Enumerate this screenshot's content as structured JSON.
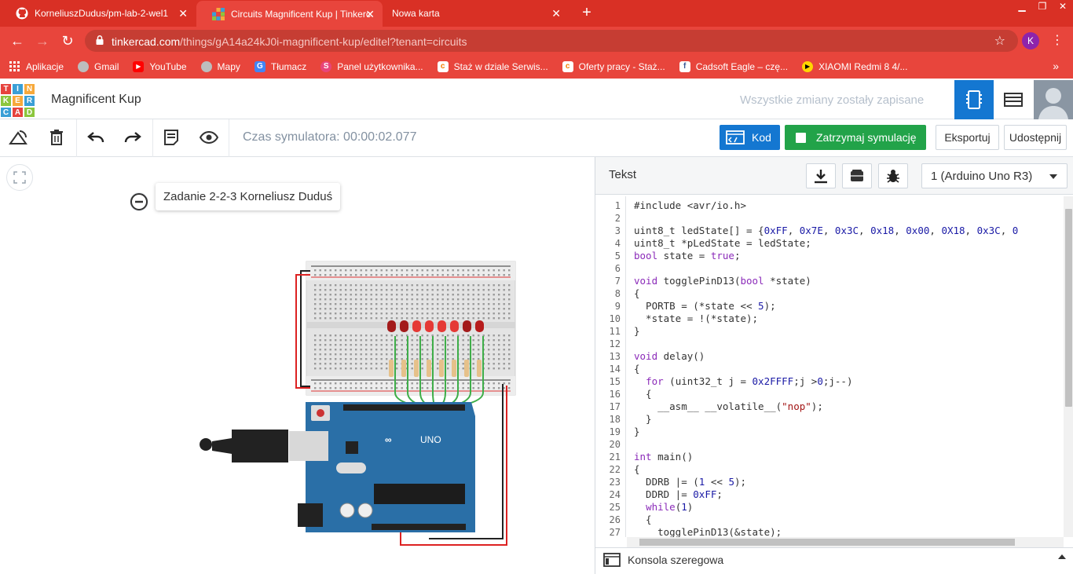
{
  "browser": {
    "tabs": [
      {
        "title": "KorneliuszDudus/pm-lab-2-wel1",
        "icon": "github-icon",
        "active": false
      },
      {
        "title": "Circuits Magnificent Kup | Tinkerc",
        "icon": "tinkercad-icon",
        "active": true
      },
      {
        "title": "Nowa karta",
        "icon": "",
        "active": false
      }
    ],
    "url_host": "tinkercad.com",
    "url_path": "/things/gA14a24kJ0i-magnificent-kup/editel?tenant=circuits",
    "profile_initial": "K",
    "bookmarks": [
      {
        "label": "Aplikacje",
        "icon": "apps-grid-icon"
      },
      {
        "label": "Gmail",
        "icon": "globe-icon"
      },
      {
        "label": "YouTube",
        "icon": "youtube-icon"
      },
      {
        "label": "Mapy",
        "icon": "globe-icon"
      },
      {
        "label": "Tłumacz",
        "icon": "translate-icon"
      },
      {
        "label": "Panel użytkownika...",
        "icon": "pink-logo-icon"
      },
      {
        "label": "Staż w dziale Serwis...",
        "icon": "orange-logo-icon"
      },
      {
        "label": "Oferty pracy - Staż...",
        "icon": "orange-logo-icon"
      },
      {
        "label": "Cadsoft Eagle – czę...",
        "icon": "facebook-icon"
      },
      {
        "label": "XIAOMI Redmi 8 4/...",
        "icon": "play-yellow-icon"
      }
    ]
  },
  "app": {
    "logo_letters": [
      "T",
      "I",
      "N",
      "K",
      "E",
      "R",
      "C",
      "A",
      "D"
    ],
    "project_title": "Magnificent Kup",
    "save_status": "Wszystkie zmiany zostały zapisane",
    "sim_time_label": "Czas symulatora: 00:00:02.077",
    "buttons": {
      "code": "Kod",
      "stop": "Zatrzymaj symulację",
      "export": "Eksportuj",
      "share": "Udostępnij"
    },
    "canvas_note": "Zadanie 2-2-3 Korneliusz Duduś"
  },
  "code_panel": {
    "title": "Tekst",
    "device": "1 (Arduino Uno R3)",
    "serial_label": "Konsola szeregowa",
    "lines": [
      "#include <avr/io.h>",
      "",
      "uint8_t ledState[] = {0xFF, 0x7E, 0x3C, 0x18, 0x00, 0X18, 0x3C, 0",
      "uint8_t *pLedState = ledState;",
      "bool state = true;",
      "",
      "void togglePinD13(bool *state)",
      "{",
      "  PORTB = (*state << 5);",
      "  *state = !(*state);",
      "}",
      "",
      "void delay()",
      "{",
      "  for (uint32_t j = 0x2FFFF;j >0;j--)",
      "  {",
      "    __asm__ __volatile__(\"nop\");",
      "  }",
      "}",
      "",
      "int main()",
      "{",
      "  DDRB |= (1 << 5);",
      "  DDRD |= 0xFF;",
      "  while(1)",
      "  {",
      "    togglePinD13(&state);",
      ""
    ]
  },
  "colors": {
    "chrome_red": "#d93025",
    "accent_blue": "#1477d1",
    "sim_green": "#22a349"
  }
}
